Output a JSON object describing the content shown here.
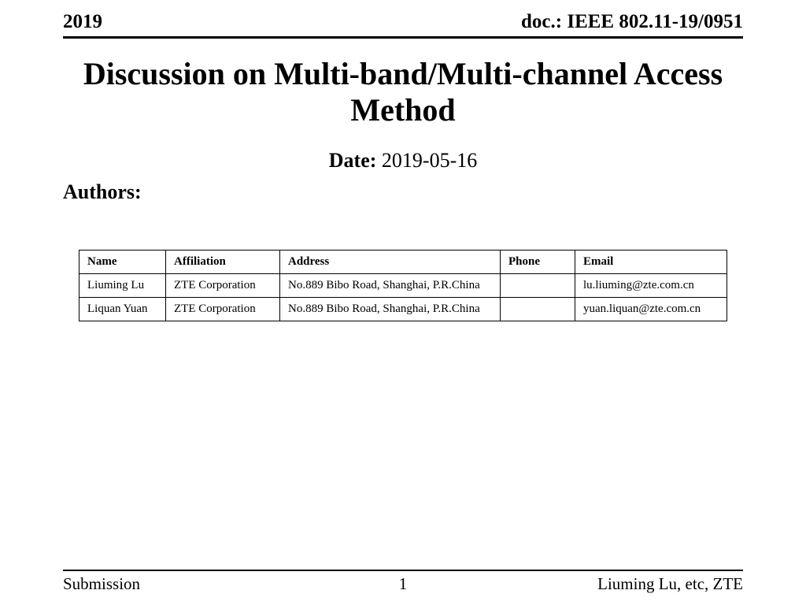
{
  "header": {
    "left": "2019",
    "right": "doc.: IEEE 802.11-19/0951"
  },
  "title": "Discussion on Multi-band/Multi-channel Access Method",
  "date": {
    "label": "Date:",
    "value": "2019-05-16"
  },
  "authors_label": "Authors:",
  "table": {
    "headers": {
      "name": "Name",
      "affiliation": "Affiliation",
      "address": "Address",
      "phone": "Phone",
      "email": "Email"
    },
    "rows": [
      {
        "name": "Liuming Lu",
        "affiliation": "ZTE Corporation",
        "address": "No.889 Bibo Road, Shanghai, P.R.China",
        "phone": "",
        "email": "lu.liuming@zte.com.cn"
      },
      {
        "name": "Liquan Yuan",
        "affiliation": "ZTE Corporation",
        "address": "No.889 Bibo Road, Shanghai, P.R.China",
        "phone": "",
        "email": "yuan.liquan@zte.com.cn"
      }
    ]
  },
  "footer": {
    "left": "Submission",
    "center": "1",
    "right": "Liuming Lu, etc, ZTE"
  }
}
